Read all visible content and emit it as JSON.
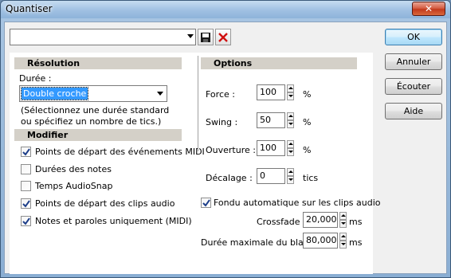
{
  "window": {
    "title": "Quantiser",
    "close_glyph": "✕"
  },
  "preset": {
    "value": "",
    "save_icon": "floppy-disk-icon",
    "delete_icon": "red-x-icon"
  },
  "buttons": {
    "ok": "OK",
    "cancel": "Annuler",
    "listen": "Écouter",
    "help": "Aide"
  },
  "resolution": {
    "header": "Résolution",
    "duration_label": "Durée :",
    "duration_value": "Double croche",
    "hint_line1": "(Sélectionnez une durée standard",
    "hint_line2": "ou spécifiez un nombre de tics.)"
  },
  "modifier": {
    "header": "Modifier",
    "items": [
      {
        "label": "Points de départ des événements MIDI",
        "checked": true
      },
      {
        "label": "Durées des notes",
        "checked": false
      },
      {
        "label": "Temps AudioSnap",
        "checked": false
      },
      {
        "label": "Points de départ des clips audio",
        "checked": true
      },
      {
        "label": "Notes et paroles uniquement (MIDI)",
        "checked": true
      }
    ]
  },
  "options": {
    "header": "Options",
    "strength": {
      "label": "Force :",
      "value": "100",
      "unit": "%"
    },
    "swing": {
      "label": "Swing :",
      "value": "50",
      "unit": "%"
    },
    "window": {
      "label": "Ouverture :",
      "value": "100",
      "unit": "%"
    },
    "offset": {
      "label": "Décalage :",
      "value": "0",
      "unit": "tics"
    },
    "autofade": {
      "label": "Fondu automatique sur les clips audio",
      "checked": true
    },
    "crossfade": {
      "label": "Crossfade :",
      "value": "20,000",
      "unit": "ms"
    },
    "max_gap": {
      "label": "Durée maximale du blanc :",
      "value": "80,000",
      "unit": "ms"
    }
  },
  "colors": {
    "accent": "#3399ff",
    "check": "#1e3f8a",
    "delete": "#d01010"
  }
}
